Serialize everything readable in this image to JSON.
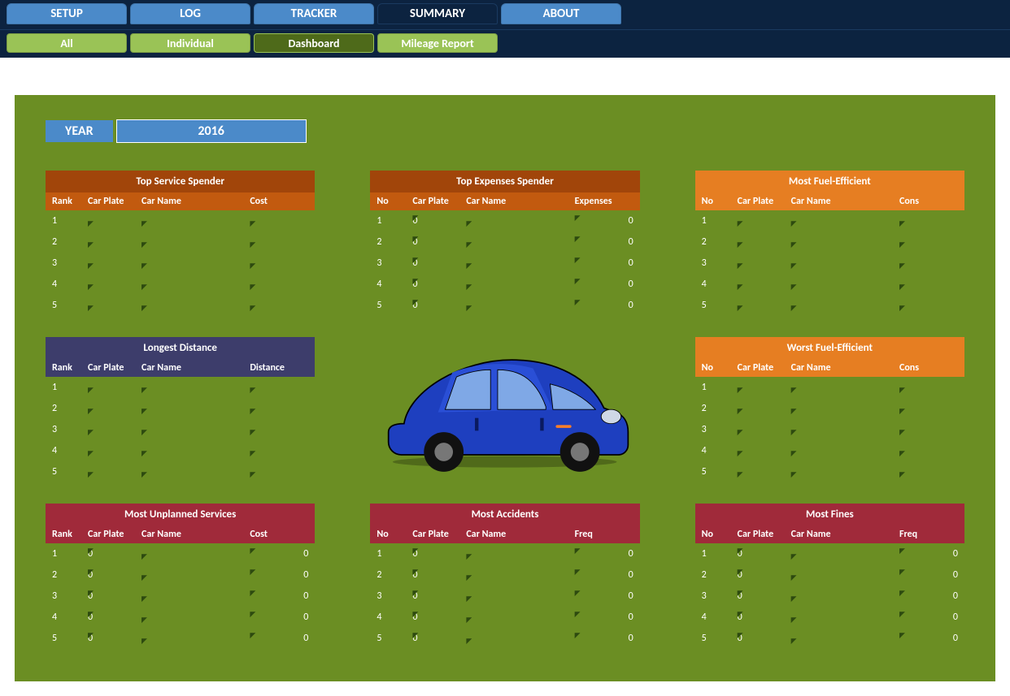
{
  "nav": {
    "main": [
      "SETUP",
      "LOG",
      "TRACKER",
      "SUMMARY",
      "ABOUT"
    ],
    "active_main": "SUMMARY",
    "sub": [
      "All",
      "Individual",
      "Dashboard",
      "Mileage Report"
    ],
    "active_sub": "Dashboard"
  },
  "year": {
    "label": "YEAR",
    "value": "2016"
  },
  "panels": {
    "top_service": {
      "title": "Top Service Spender",
      "headers": [
        "Rank",
        "Car Plate",
        "Car Name",
        "Cost"
      ],
      "rows": [
        {
          "c1": "1",
          "c2": "",
          "c3": "",
          "c4": ""
        },
        {
          "c1": "2",
          "c2": "",
          "c3": "",
          "c4": ""
        },
        {
          "c1": "3",
          "c2": "",
          "c3": "",
          "c4": ""
        },
        {
          "c1": "4",
          "c2": "",
          "c3": "",
          "c4": ""
        },
        {
          "c1": "5",
          "c2": "",
          "c3": "",
          "c4": ""
        }
      ]
    },
    "top_expenses": {
      "title": "Top Expenses Spender",
      "headers": [
        "No",
        "Car Plate",
        "Car Name",
        "Expenses"
      ],
      "rows": [
        {
          "c1": "1",
          "c2": "0",
          "c3": "",
          "c4": "0"
        },
        {
          "c1": "2",
          "c2": "0",
          "c3": "",
          "c4": "0"
        },
        {
          "c1": "3",
          "c2": "0",
          "c3": "",
          "c4": "0"
        },
        {
          "c1": "4",
          "c2": "0",
          "c3": "",
          "c4": "0"
        },
        {
          "c1": "5",
          "c2": "0",
          "c3": "",
          "c4": "0"
        }
      ]
    },
    "most_fuel_eff": {
      "title": "Most Fuel-Efficient",
      "headers": [
        "No",
        "Car Plate",
        "Car Name",
        "Cons"
      ],
      "rows": [
        {
          "c1": "1",
          "c2": "",
          "c3": "",
          "c4": ""
        },
        {
          "c1": "2",
          "c2": "",
          "c3": "",
          "c4": ""
        },
        {
          "c1": "3",
          "c2": "",
          "c3": "",
          "c4": ""
        },
        {
          "c1": "4",
          "c2": "",
          "c3": "",
          "c4": ""
        },
        {
          "c1": "5",
          "c2": "",
          "c3": "",
          "c4": ""
        }
      ]
    },
    "longest_dist": {
      "title": "Longest Distance",
      "headers": [
        "Rank",
        "Car Plate",
        "Car Name",
        "Distance"
      ],
      "rows": [
        {
          "c1": "1",
          "c2": "",
          "c3": "",
          "c4": ""
        },
        {
          "c1": "2",
          "c2": "",
          "c3": "",
          "c4": ""
        },
        {
          "c1": "3",
          "c2": "",
          "c3": "",
          "c4": ""
        },
        {
          "c1": "4",
          "c2": "",
          "c3": "",
          "c4": ""
        },
        {
          "c1": "5",
          "c2": "",
          "c3": "",
          "c4": ""
        }
      ]
    },
    "worst_fuel_eff": {
      "title": "Worst Fuel-Efficient",
      "headers": [
        "No",
        "Car Plate",
        "Car Name",
        "Cons"
      ],
      "rows": [
        {
          "c1": "1",
          "c2": "",
          "c3": "",
          "c4": ""
        },
        {
          "c1": "2",
          "c2": "",
          "c3": "",
          "c4": ""
        },
        {
          "c1": "3",
          "c2": "",
          "c3": "",
          "c4": ""
        },
        {
          "c1": "4",
          "c2": "",
          "c3": "",
          "c4": ""
        },
        {
          "c1": "5",
          "c2": "",
          "c3": "",
          "c4": ""
        }
      ]
    },
    "most_unplanned": {
      "title": "Most Unplanned Services",
      "headers": [
        "Rank",
        "Car Plate",
        "Car Name",
        "Cost"
      ],
      "rows": [
        {
          "c1": "1",
          "c2": "0",
          "c3": "",
          "c4": "0"
        },
        {
          "c1": "2",
          "c2": "0",
          "c3": "",
          "c4": "0"
        },
        {
          "c1": "3",
          "c2": "0",
          "c3": "",
          "c4": "0"
        },
        {
          "c1": "4",
          "c2": "0",
          "c3": "",
          "c4": "0"
        },
        {
          "c1": "5",
          "c2": "0",
          "c3": "",
          "c4": "0"
        }
      ]
    },
    "most_accidents": {
      "title": "Most Accidents",
      "headers": [
        "No",
        "Car Plate",
        "Car Name",
        "Freq"
      ],
      "rows": [
        {
          "c1": "1",
          "c2": "0",
          "c3": "",
          "c4": "0"
        },
        {
          "c1": "2",
          "c2": "0",
          "c3": "",
          "c4": "0"
        },
        {
          "c1": "3",
          "c2": "0",
          "c3": "",
          "c4": "0"
        },
        {
          "c1": "4",
          "c2": "0",
          "c3": "",
          "c4": "0"
        },
        {
          "c1": "5",
          "c2": "0",
          "c3": "",
          "c4": "0"
        }
      ]
    },
    "most_fines": {
      "title": "Most Fines",
      "headers": [
        "No",
        "Car Plate",
        "Car Name",
        "Freq"
      ],
      "rows": [
        {
          "c1": "1",
          "c2": "0",
          "c3": "",
          "c4": "0"
        },
        {
          "c1": "2",
          "c2": "0",
          "c3": "",
          "c4": "0"
        },
        {
          "c1": "3",
          "c2": "0",
          "c3": "",
          "c4": "0"
        },
        {
          "c1": "4",
          "c2": "0",
          "c3": "",
          "c4": "0"
        },
        {
          "c1": "5",
          "c2": "0",
          "c3": "",
          "c4": "0"
        }
      ]
    }
  }
}
